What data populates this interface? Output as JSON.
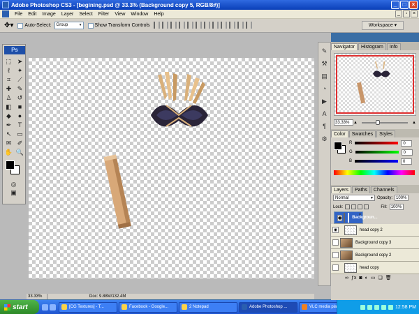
{
  "window": {
    "title": "Adobe Photoshop CS3 - [begining.psd @ 33.3% (Background copy 5, RGB/8#)]"
  },
  "menu": [
    "File",
    "Edit",
    "Image",
    "Layer",
    "Select",
    "Filter",
    "View",
    "Window",
    "Help"
  ],
  "options_bar": {
    "auto_select_label": "Auto-Select:",
    "group_value": "Group",
    "transform_label": "Show Transform Controls",
    "workspace_label": "Workspace ▾"
  },
  "toolbox": {
    "logo": "Ps"
  },
  "status": {
    "zoom": "33.33%",
    "doc": "Doc: 9.88M/132.4M"
  },
  "navigator": {
    "tabs": [
      "Navigator",
      "Histogram",
      "Info"
    ],
    "zoom": "33.33%"
  },
  "color": {
    "tabs": [
      "Color",
      "Swatches",
      "Styles"
    ],
    "channels": [
      {
        "label": "R",
        "value": "0",
        "color": "#e02020"
      },
      {
        "label": "G",
        "value": "0",
        "color": "#20b020"
      },
      {
        "label": "B",
        "value": "0",
        "color": "#2030e0"
      }
    ]
  },
  "layers": {
    "tabs": [
      "Layers",
      "Paths",
      "Channels"
    ],
    "blend_mode": "Normal",
    "opacity_label": "Opacity:",
    "opacity": "100%",
    "lock_label": "Lock:",
    "fill_label": "Fill:",
    "fill": "100%",
    "items": [
      {
        "name": "Backgroun...",
        "selected": true
      },
      {
        "name": "head copy 2",
        "selected": false
      },
      {
        "name": "Background copy 3",
        "selected": false
      },
      {
        "name": "Background copy 2",
        "selected": false
      },
      {
        "name": "head copy",
        "selected": false
      }
    ]
  },
  "taskbar": {
    "start_label": "start",
    "tasks": [
      {
        "label": "[CG Textures] - T...",
        "active": false
      },
      {
        "label": "Facebook - Google...",
        "active": false
      },
      {
        "label": "2 Notepad",
        "active": false
      },
      {
        "label": "Adobe Photoshop ...",
        "active": true
      },
      {
        "label": "VLC media player",
        "active": false
      }
    ],
    "clock": "12:58 PM"
  }
}
